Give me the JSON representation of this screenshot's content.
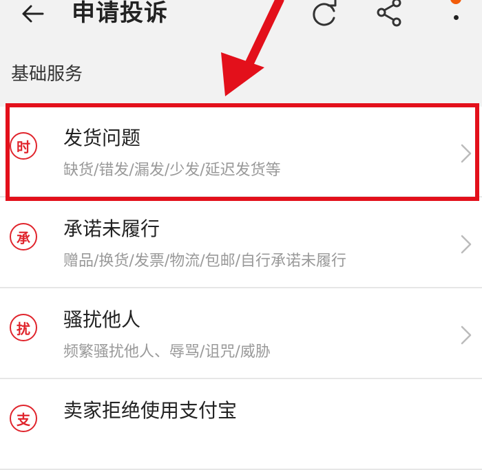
{
  "header": {
    "title": "申请投诉",
    "back_icon": "arrow-left-icon",
    "refresh_icon": "refresh-icon",
    "share_icon": "share-icon",
    "more_icon": "more-vertical-icon"
  },
  "section": {
    "title": "基础服务"
  },
  "items": [
    {
      "icon_text": "时",
      "title": "发货问题",
      "desc": "缺货/错发/漏发/少发/延迟发货等"
    },
    {
      "icon_text": "承",
      "title": "承诺未履行",
      "desc": "赠品/换货/发票/物流/包邮/自行承诺未履行"
    },
    {
      "icon_text": "扰",
      "title": "骚扰他人",
      "desc": "频繁骚扰他人、辱骂/诅咒/威胁"
    },
    {
      "icon_text": "支",
      "title": "卖家拒绝使用支付宝",
      "desc": ""
    }
  ],
  "colors": {
    "accent_red": "#e0242c",
    "annotation_red": "#e3101b",
    "badge_orange": "#f25c0a"
  }
}
